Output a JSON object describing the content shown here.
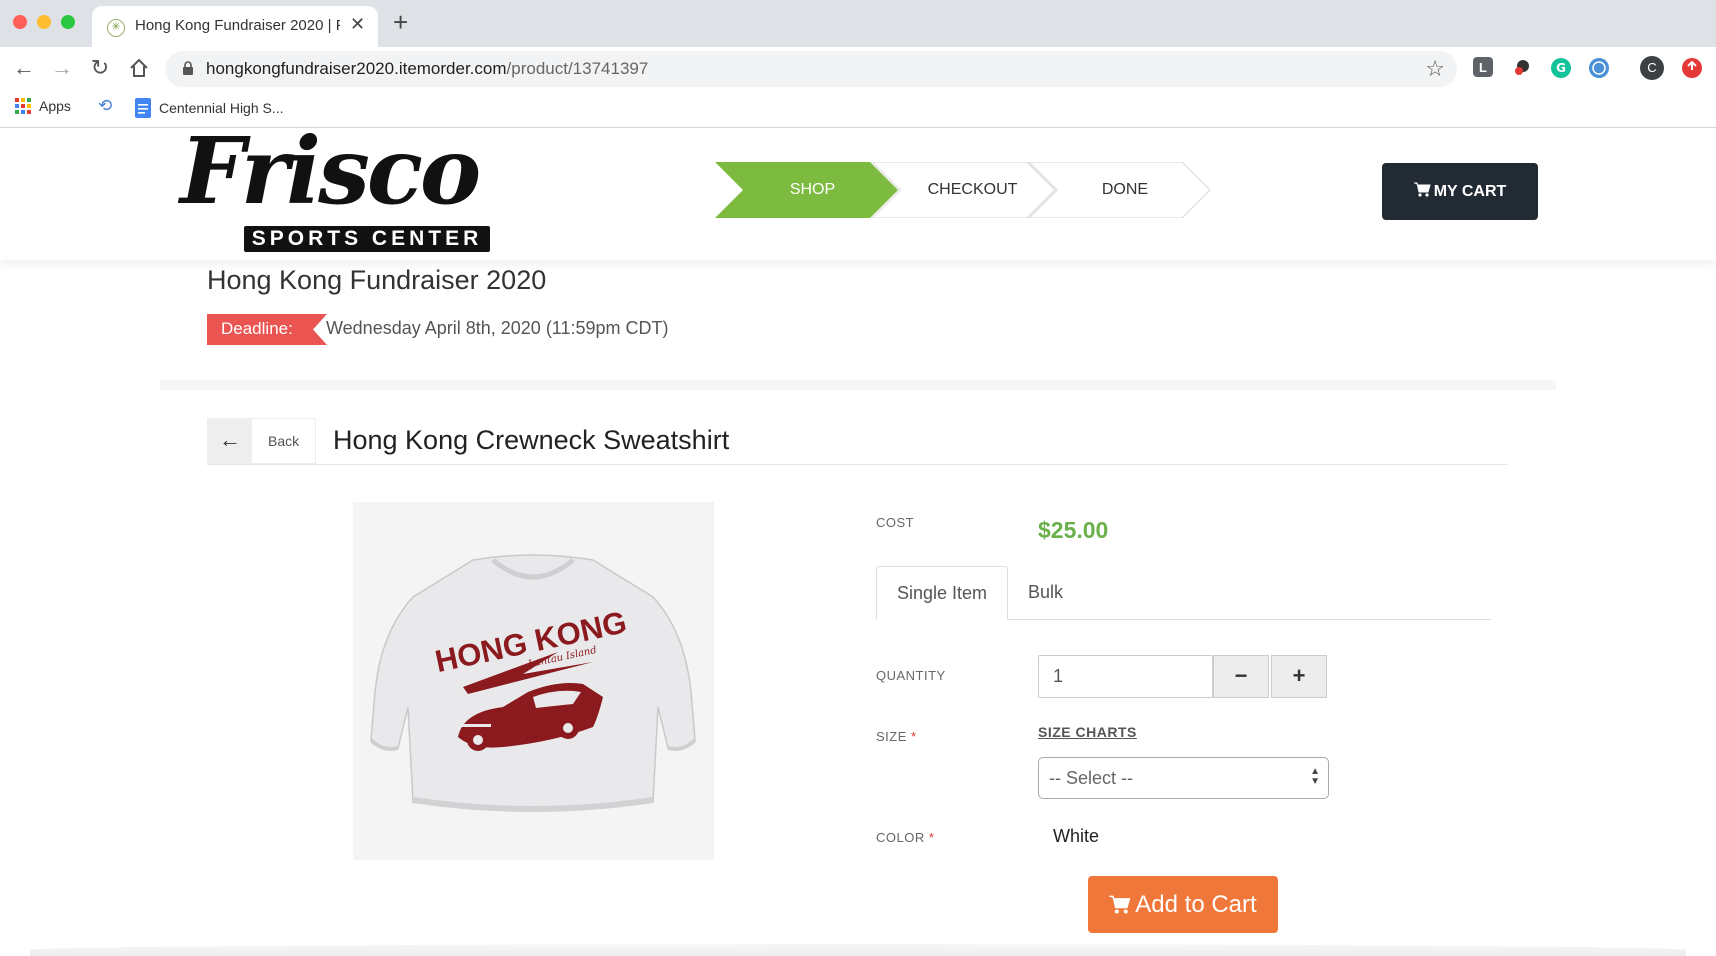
{
  "browser": {
    "tab_title": "Hong Kong Fundraiser 2020 | F",
    "url_host": "hongkongfundraiser2020.itemorder.com",
    "url_path": "/product/13741397",
    "bookmarks": {
      "apps": "Apps",
      "centennial": "Centennial High S..."
    },
    "profile_letter": "C"
  },
  "header": {
    "logo": {
      "script": "Frisco",
      "band": "SPORTS CENTER"
    },
    "steps": [
      "SHOP",
      "CHECKOUT",
      "DONE"
    ],
    "cart_label": "MY CART"
  },
  "store": {
    "title": "Hong Kong Fundraiser 2020",
    "deadline_label": "Deadline:",
    "deadline_value": "Wednesday April 8th, 2020 (11:59pm CDT)"
  },
  "product": {
    "back_label": "Back",
    "title": "Hong Kong Crewneck Sweatshirt",
    "image_text": {
      "line1": "HONG KONG",
      "line2": "Lantau Island"
    },
    "cost_label": "COST",
    "price": "$25.00",
    "tabs": [
      "Single Item",
      "Bulk"
    ],
    "quantity_label": "QUANTITY",
    "quantity_value": "1",
    "size_label": "SIZE",
    "size_charts": "SIZE CHARTS",
    "size_select": "-- Select --",
    "color_label": "COLOR",
    "color_value": "White",
    "required_mark": "*",
    "add_to_cart": "Add to Cart"
  },
  "colors": {
    "accent_green": "#7cbb3f",
    "price_green": "#6ab04c",
    "deadline_red": "#ea5451",
    "cart_dark": "#222a33",
    "add_orange": "#f0773a",
    "print_maroon": "#8b1a1e"
  }
}
